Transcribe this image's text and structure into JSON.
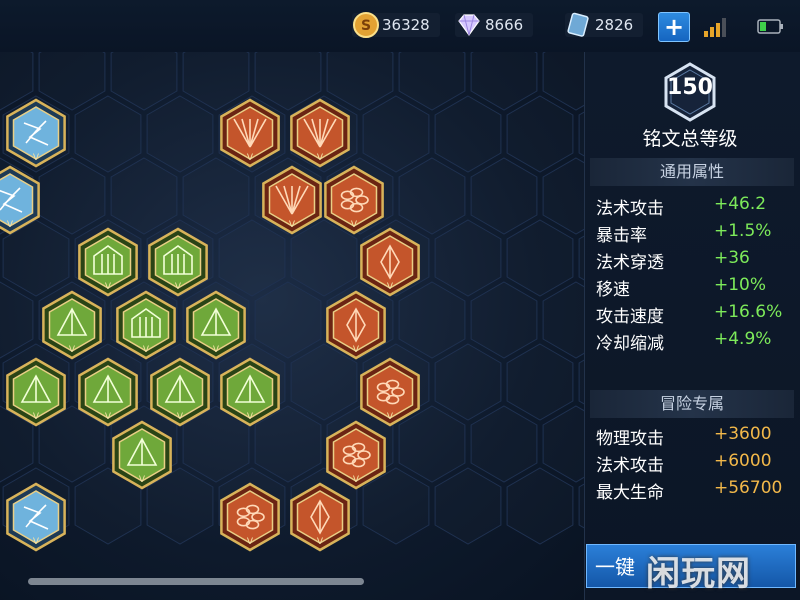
{
  "currencies": {
    "gold": {
      "value": "36328",
      "icon": "gold-coin-icon"
    },
    "diamond": {
      "value": "8666",
      "icon": "diamond-icon"
    },
    "ticket": {
      "value": "2826",
      "icon": "ticket-card-icon"
    }
  },
  "status": {
    "signal_icon": "signal-bars-icon",
    "battery_icon": "battery-icon"
  },
  "panel": {
    "level": "150",
    "level_label": "铭文总等级",
    "general_header": "通用属性",
    "general_stats": [
      {
        "name": "法术攻击",
        "value": "+46.2"
      },
      {
        "name": "暴击率",
        "value": "+1.5%"
      },
      {
        "name": "法术穿透",
        "value": "+36"
      },
      {
        "name": "移速",
        "value": "+10%"
      },
      {
        "name": "攻击速度",
        "value": "+16.6%"
      },
      {
        "name": "冷却缩减",
        "value": "+4.9%"
      }
    ],
    "adventure_header": "冒险专属",
    "adventure_stats": [
      {
        "name": "物理攻击",
        "value": "+3600"
      },
      {
        "name": "法术攻击",
        "value": "+6000"
      },
      {
        "name": "最大生命",
        "value": "+56700"
      }
    ],
    "onekey_label": "一键"
  },
  "watermark": "闲玩网",
  "colors": {
    "stat_green": "#7dea5a",
    "stat_orange": "#f2b84a",
    "rune_red": "#c4552b",
    "rune_green": "#6fa83a",
    "rune_blue": "#6fb3dd",
    "frame_gold": "#d8b35a"
  },
  "runes": [
    {
      "type": "blue",
      "icon": "blue-rune-icon"
    },
    {
      "type": "blue",
      "icon": "blue-rune-icon"
    },
    {
      "type": "blue",
      "icon": "blue-rune-icon"
    },
    {
      "type": "red",
      "icon": "red-rune-fan-icon"
    },
    {
      "type": "red",
      "icon": "red-rune-fan-icon"
    },
    {
      "type": "red",
      "icon": "red-rune-fan-icon"
    },
    {
      "type": "red",
      "icon": "red-rune-flower-icon"
    },
    {
      "type": "red",
      "icon": "red-rune-crystal-icon"
    },
    {
      "type": "red",
      "icon": "red-rune-crystal-icon"
    },
    {
      "type": "red",
      "icon": "red-rune-flower-icon"
    },
    {
      "type": "red",
      "icon": "red-rune-flower-icon"
    },
    {
      "type": "red",
      "icon": "red-rune-flower-icon"
    },
    {
      "type": "red",
      "icon": "red-rune-crystal-icon"
    },
    {
      "type": "green",
      "icon": "green-rune-gate-icon"
    },
    {
      "type": "green",
      "icon": "green-rune-gate-icon"
    },
    {
      "type": "green",
      "icon": "green-rune-gate-icon"
    },
    {
      "type": "green",
      "icon": "green-rune-leaf-icon"
    },
    {
      "type": "green",
      "icon": "green-rune-leaf-icon"
    },
    {
      "type": "green",
      "icon": "green-rune-leaf-icon"
    },
    {
      "type": "green",
      "icon": "green-rune-leaf-icon"
    },
    {
      "type": "green",
      "icon": "green-rune-leaf-icon"
    },
    {
      "type": "green",
      "icon": "green-rune-leaf-icon"
    },
    {
      "type": "green",
      "icon": "green-rune-leaf-icon"
    }
  ]
}
